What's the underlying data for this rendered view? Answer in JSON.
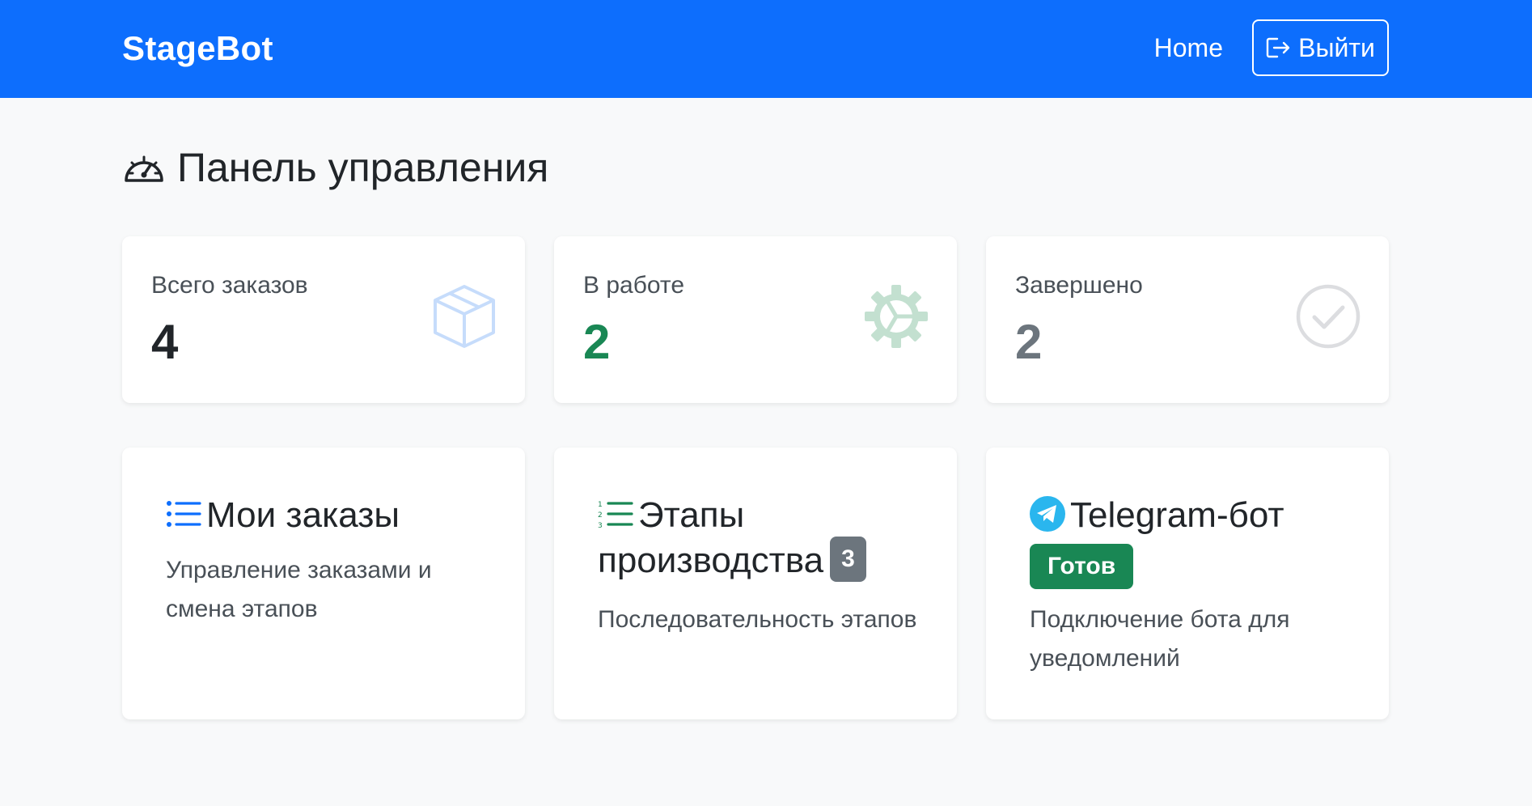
{
  "navbar": {
    "brand": "StageBot",
    "home_label": "Home",
    "logout_label": "Выйти"
  },
  "page": {
    "title": "Панель управления"
  },
  "stats": [
    {
      "label": "Всего заказов",
      "value": "4",
      "value_color": "#212529",
      "icon": "box-icon",
      "icon_color": "#c6dcfb"
    },
    {
      "label": "В работе",
      "value": "2",
      "value_color": "#198754",
      "icon": "gear-icon",
      "icon_color": "#c3e0d0"
    },
    {
      "label": "Завершено",
      "value": "2",
      "value_color": "#6c757d",
      "icon": "check-circle-icon",
      "icon_color": "#dcdde0"
    }
  ],
  "features": [
    {
      "title": "Мои заказы",
      "description": "Управление заказами и смена этапов",
      "icon": "list-icon",
      "icon_color": "#0d6efd"
    },
    {
      "title": "Этапы производства",
      "badge": "3",
      "description": "Последовательность этапов",
      "icon": "ordered-list-icon",
      "icon_color": "#198754"
    },
    {
      "title": "Telegram-бот",
      "badge": "Готов",
      "description": "Подключение бота для уведомлений",
      "icon": "telegram-icon",
      "icon_color": "#2ab6ee"
    }
  ],
  "colors": {
    "primary": "#0d6efd",
    "success": "#198754",
    "secondary": "#6c757d",
    "background": "#f8f9fa"
  }
}
